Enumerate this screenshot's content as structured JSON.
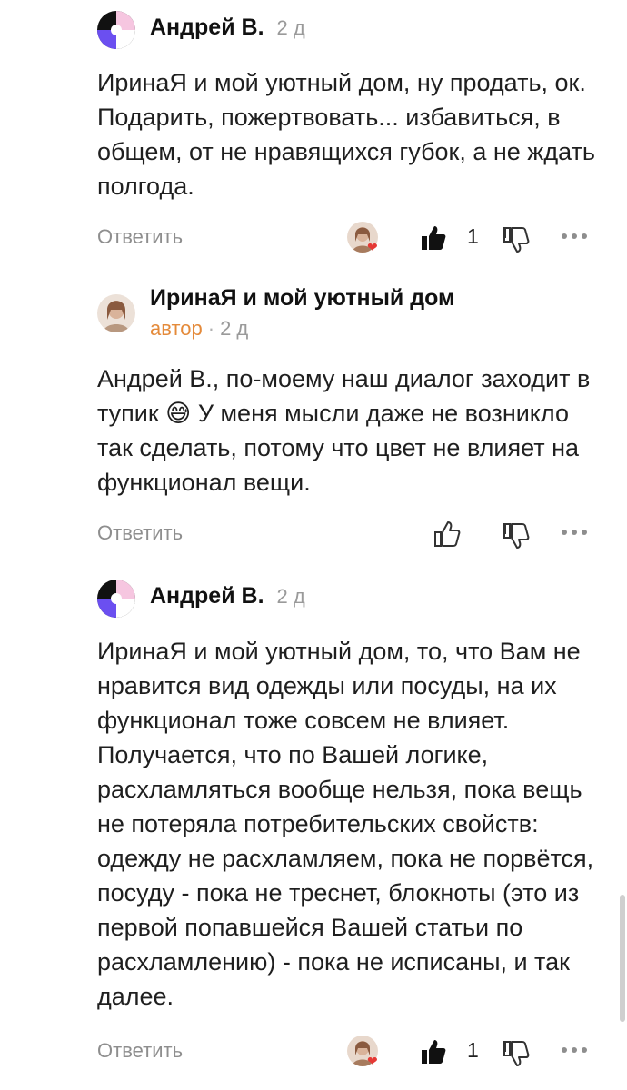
{
  "comments": [
    {
      "author": "Андрей В.",
      "time": "2 д",
      "text": "ИринаЯ и мой уютный дом, ну продать, ок. Подарить, пожертвовать... избавиться, в общем, от не нравящихся губок, а не ждать полгода.",
      "reply_label": "Ответить",
      "likes": "1",
      "liked_by_author": true,
      "avatar_type": "geometric"
    },
    {
      "author": "ИринаЯ и мой уютный дом",
      "author_tag": "автор",
      "time": "2 д",
      "text": "Андрей В., по-моему наш диалог заходит в тупик 😅 У меня мысли даже не возникло так сделать, потому что цвет не влияет на функционал вещи.",
      "reply_label": "Ответить",
      "likes": "",
      "avatar_type": "photo"
    },
    {
      "author": "Андрей В.",
      "time": "2 д",
      "text": "ИринаЯ и мой уютный дом, то, что Вам не нравится вид одежды или посуды, на их функционал тоже совсем не влияет. Получается, что по Вашей логике, расхламляться вообще нельзя, пока вещь не потеряла потребительских свойств: одежду не расхламляем, пока не порвётся, посуду - пока не треснет, блокноты (это из первой попавшейся Вашей статьи по расхламлению) - пока не исписаны, и так далее.",
      "reply_label": "Ответить",
      "likes": "1",
      "liked_by_author": true,
      "avatar_type": "geometric"
    }
  ],
  "colors": {
    "author_tag": "#e48a3a",
    "meta": "#9a9a9a",
    "text": "#1f1f1f",
    "heart": "#e53935"
  }
}
